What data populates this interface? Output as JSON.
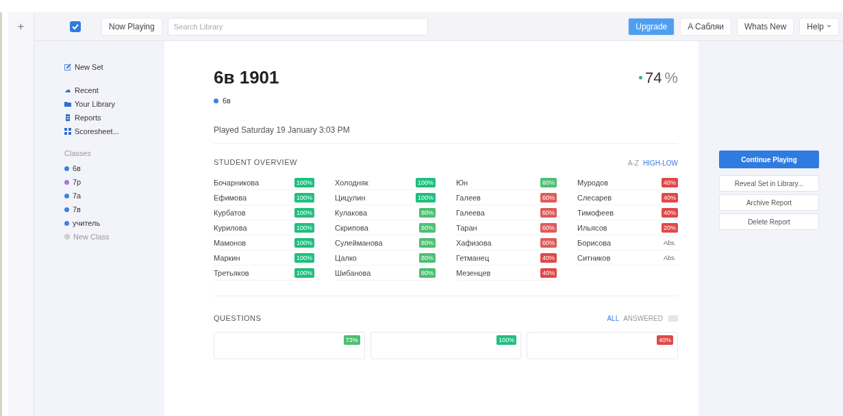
{
  "toolbar": {
    "add": "+",
    "checkbox": {
      "checked": true
    },
    "now_playing": "Now Playing",
    "search": {
      "placeholder": "Search Library"
    },
    "buttons": [
      {
        "label": "Upgrade",
        "kind": "primary"
      },
      {
        "label": "A Сабляи",
        "kind": "plain"
      },
      {
        "label": "Whats New",
        "kind": "plain"
      },
      {
        "label": "Help",
        "kind": "menu"
      }
    ]
  },
  "sidebar": {
    "new_set": "New Set",
    "items": [
      {
        "label": "Recent"
      },
      {
        "label": "Your Library"
      },
      {
        "label": "Reports"
      },
      {
        "label": "Scoresheet..."
      }
    ],
    "classes_heading": "Classes",
    "classes": [
      {
        "label": "6в",
        "color": "#3b82e0"
      },
      {
        "label": "7р",
        "color": "#a07ad6"
      },
      {
        "label": "7а",
        "color": "#3b82e0"
      },
      {
        "label": "7в",
        "color": "#3b82e0"
      },
      {
        "label": "учитель",
        "color": "#3b82e0"
      }
    ],
    "new_class": "New Class"
  },
  "report": {
    "title": "6в 1901",
    "class": {
      "label": "6в",
      "color": "#3b82e0"
    },
    "score": "74",
    "score_unit": "%",
    "played": "Played Saturday 19 January 3:03 PM",
    "overview_heading": "STUDENT OVERVIEW",
    "sorts": [
      {
        "label": "A-Z",
        "selected": false
      },
      {
        "label": "HIGH-LOW",
        "selected": true
      }
    ],
    "students": [
      [
        {
          "name": "Бочарникова",
          "score": "100%",
          "color": "#1fbf7f"
        },
        {
          "name": "Ефимова",
          "score": "100%",
          "color": "#1fbf7f"
        },
        {
          "name": "Курбатов",
          "score": "100%",
          "color": "#1fbf7f"
        },
        {
          "name": "Курилова",
          "score": "100%",
          "color": "#1fbf7f"
        },
        {
          "name": "Мамонов",
          "score": "100%",
          "color": "#1fbf7f"
        },
        {
          "name": "Маркин",
          "score": "100%",
          "color": "#1fbf7f"
        },
        {
          "name": "Третьяков",
          "score": "100%",
          "color": "#1fbf7f"
        }
      ],
      [
        {
          "name": "Холодняк",
          "score": "100%",
          "color": "#1fbf7f"
        },
        {
          "name": "Цицулин",
          "score": "100%",
          "color": "#1fbf7f"
        },
        {
          "name": "Кулакова",
          "score": "80%",
          "color": "#4cbf72"
        },
        {
          "name": "Скрипова",
          "score": "80%",
          "color": "#4cbf72"
        },
        {
          "name": "Сулейманова",
          "score": "80%",
          "color": "#4cbf72"
        },
        {
          "name": "Цалко",
          "score": "80%",
          "color": "#4cbf72"
        },
        {
          "name": "Шибанова",
          "score": "80%",
          "color": "#4cbf72"
        }
      ],
      [
        {
          "name": "Юн",
          "score": "80%",
          "color": "#4cbf72"
        },
        {
          "name": "Галеев",
          "score": "60%",
          "color": "#e05a5a"
        },
        {
          "name": "Галеева",
          "score": "60%",
          "color": "#e05a5a"
        },
        {
          "name": "Таран",
          "score": "60%",
          "color": "#e05a5a"
        },
        {
          "name": "Хафизова",
          "score": "60%",
          "color": "#e05a5a"
        },
        {
          "name": "Гетманец",
          "score": "40%",
          "color": "#e04848"
        },
        {
          "name": "Мезенцев",
          "score": "40%",
          "color": "#e04848"
        }
      ],
      [
        {
          "name": "Муродов",
          "score": "40%",
          "color": "#e04848"
        },
        {
          "name": "Слесарев",
          "score": "40%",
          "color": "#e04848"
        },
        {
          "name": "Тимофеев",
          "score": "40%",
          "color": "#e04848"
        },
        {
          "name": "Ильясов",
          "score": "20%",
          "color": "#e04848"
        },
        {
          "name": "Борисова",
          "score": "Abs.",
          "color": "#ffffff"
        },
        {
          "name": "Ситников",
          "score": "Abs.",
          "color": "#ffffff"
        }
      ]
    ],
    "questions_heading": "QUESTIONS",
    "filters": [
      {
        "label": "ALL",
        "selected": true
      },
      {
        "label": "ANSWERED",
        "selected": false
      }
    ],
    "questions": [
      {
        "score": "73%",
        "color": "#4cbf72"
      },
      {
        "score": "100%",
        "color": "#1fbf7f"
      },
      {
        "score": "40%",
        "color": "#e04848"
      }
    ]
  },
  "actions": [
    {
      "label": "Continue Playing",
      "kind": "primary"
    },
    {
      "label": "Reveal Set in Library...",
      "kind": "plain"
    },
    {
      "label": "Archive Report",
      "kind": "plain"
    },
    {
      "label": "Delete Report",
      "kind": "plain"
    }
  ]
}
